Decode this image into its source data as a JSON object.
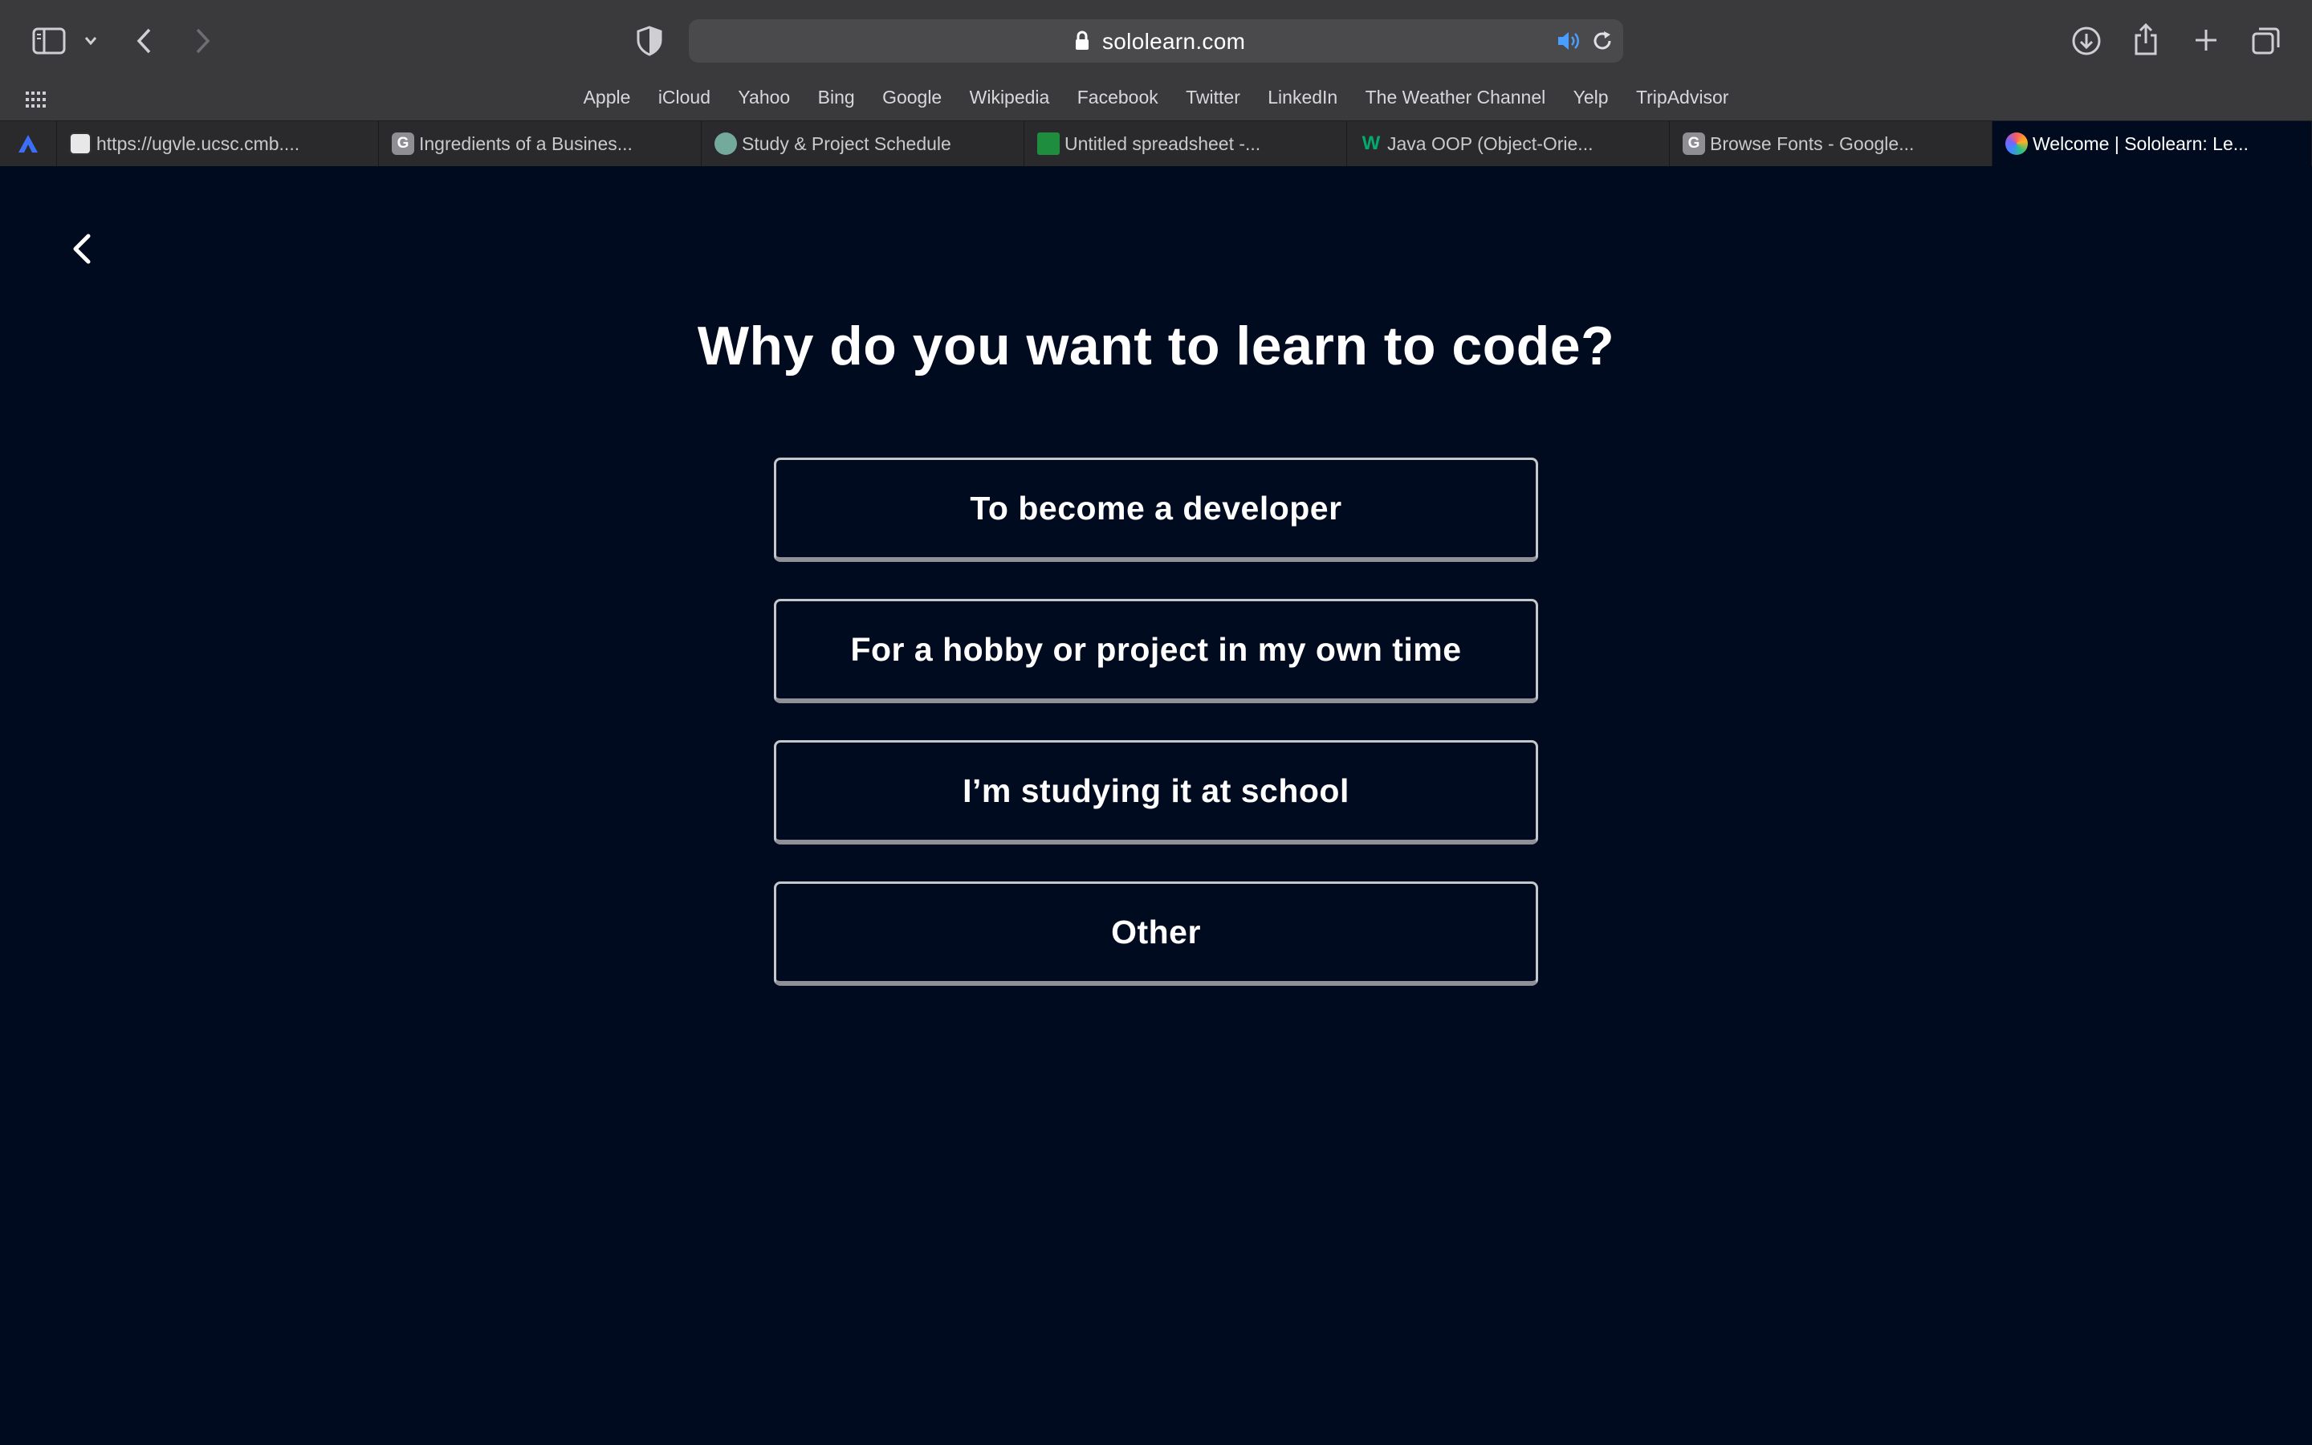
{
  "browser": {
    "url": "sololearn.com",
    "favorites": [
      "Apple",
      "iCloud",
      "Yahoo",
      "Bing",
      "Google",
      "Wikipedia",
      "Facebook",
      "Twitter",
      "LinkedIn",
      "The Weather Channel",
      "Yelp",
      "TripAdvisor"
    ],
    "tabs": [
      {
        "label": "https://ugvle.ucsc.cmb....",
        "favicon_letter": "",
        "favicon_color": "#e8e8e8"
      },
      {
        "label": "Ingredients of a Busines...",
        "favicon_letter": "G",
        "favicon_color": "#8e8e93"
      },
      {
        "label": "Study & Project Schedule",
        "favicon_letter": "",
        "favicon_color": "#74aa9c"
      },
      {
        "label": "Untitled spreadsheet -...",
        "favicon_letter": "",
        "favicon_color": "#1e8e3e"
      },
      {
        "label": "Java OOP (Object-Orie...",
        "favicon_letter": "W",
        "favicon_color": "#04aa6d"
      },
      {
        "label": "Browse Fonts - Google...",
        "favicon_letter": "G",
        "favicon_color": "#8e8e93"
      },
      {
        "label": "Welcome | Sololearn: Le...",
        "favicon_letter": "",
        "favicon_color": "#7b61ff",
        "active": true
      }
    ],
    "colors": {
      "chrome": "#3a3a3c",
      "tabbar": "#2a2a2c",
      "audio_icon": "#4a9eff"
    }
  },
  "page": {
    "question": "Why do you want to learn to code?",
    "options": [
      "To become a developer",
      "For a hobby or project in my own time",
      "I’m studying it at school",
      "Other"
    ],
    "colors": {
      "background": "#000b1f",
      "text": "#ffffff",
      "option_border": "#c4c7cc"
    }
  }
}
